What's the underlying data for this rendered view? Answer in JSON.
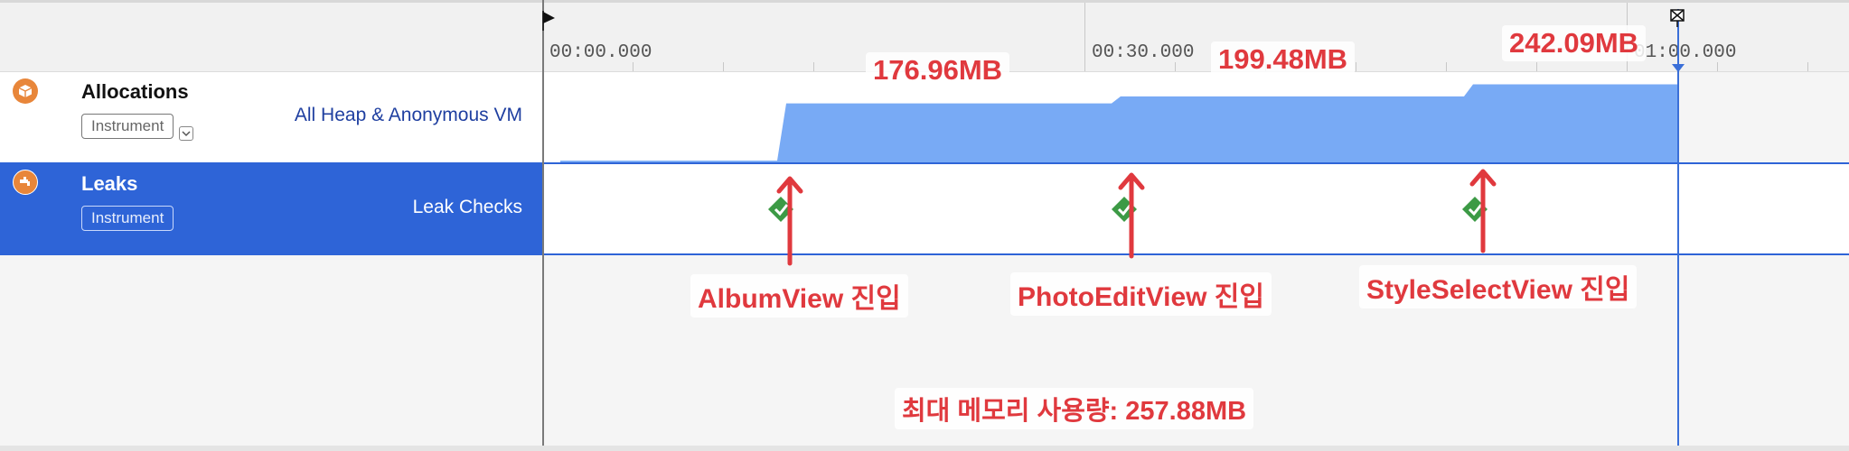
{
  "tracks": [
    {
      "title": "Allocations",
      "badge": "Instrument",
      "detail": "All Heap & Anonymous VM",
      "icon": "allocations-icon",
      "icon_color": "#e8863a"
    },
    {
      "title": "Leaks",
      "badge": "Instrument",
      "detail": "Leak Checks",
      "icon": "leaks-icon",
      "icon_color": "#e8863a",
      "selected": true
    }
  ],
  "ruler": {
    "labels": [
      "00:00.000",
      "00:30.000",
      "01:00.000"
    ]
  },
  "allocation_graph": {
    "color": "#78aaf5",
    "unit": "MB",
    "points": [
      {
        "t": 1,
        "mb": 5
      },
      {
        "t": 13,
        "mb": 5
      },
      {
        "t": 13.5,
        "mb": 170
      },
      {
        "t": 31.5,
        "mb": 170
      },
      {
        "t": 32,
        "mb": 190
      },
      {
        "t": 51,
        "mb": 190
      },
      {
        "t": 51.5,
        "mb": 225
      },
      {
        "t": 63,
        "mb": 225
      }
    ]
  },
  "leak_checks": [
    {
      "t": 13.2,
      "status": "ok"
    },
    {
      "t": 32.2,
      "status": "ok"
    },
    {
      "t": 51.6,
      "status": "ok"
    }
  ],
  "annotations": {
    "mem1": "176.96MB",
    "mem2": "199.48MB",
    "mem3": "242.09MB",
    "view1": "AlbumView 진입",
    "view2": "PhotoEditView 진입",
    "view3": "StyleSelectView 진입",
    "max": "최대 메모리 사용량: 257.88MB"
  },
  "colors": {
    "selected_row": "#2e64d7",
    "annotation_red": "#e0393e",
    "check_green": "#3c9a45",
    "detail_blue": "#1f3fa0"
  }
}
